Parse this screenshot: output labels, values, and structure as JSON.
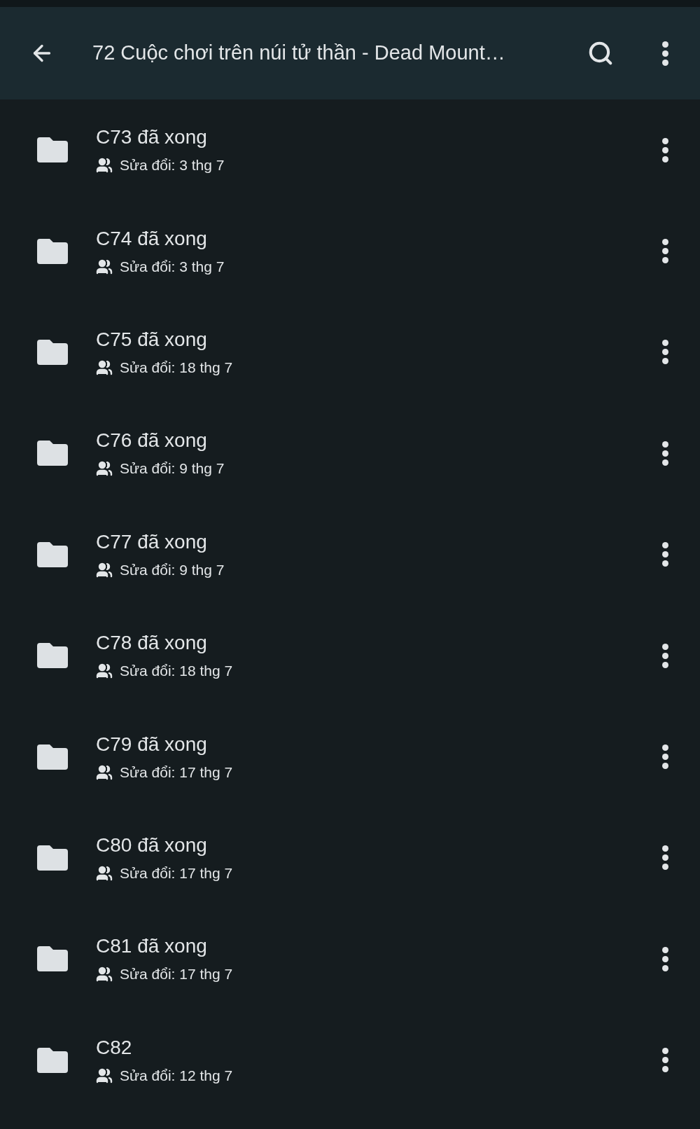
{
  "app_bar": {
    "title": "72 Cuộc chơi trên núi tử thần - Dead Mount…"
  },
  "files": [
    {
      "name": "C73 đã xong",
      "modified": "Sửa đổi: 3 thg 7"
    },
    {
      "name": "C74 đã xong",
      "modified": "Sửa đổi: 3 thg 7"
    },
    {
      "name": "C75 đã xong",
      "modified": "Sửa đổi: 18 thg 7"
    },
    {
      "name": "C76 đã xong",
      "modified": "Sửa đổi: 9 thg 7"
    },
    {
      "name": "C77 đã xong",
      "modified": "Sửa đổi: 9 thg 7"
    },
    {
      "name": "C78 đã xong",
      "modified": "Sửa đổi: 18 thg 7"
    },
    {
      "name": "C79 đã xong",
      "modified": "Sửa đổi: 17 thg 7"
    },
    {
      "name": "C80 đã xong",
      "modified": "Sửa đổi: 17 thg 7"
    },
    {
      "name": "C81 đã xong",
      "modified": "Sửa đổi: 17 thg 7"
    },
    {
      "name": "C82",
      "modified": "Sửa đổi: 12 thg 7"
    }
  ]
}
